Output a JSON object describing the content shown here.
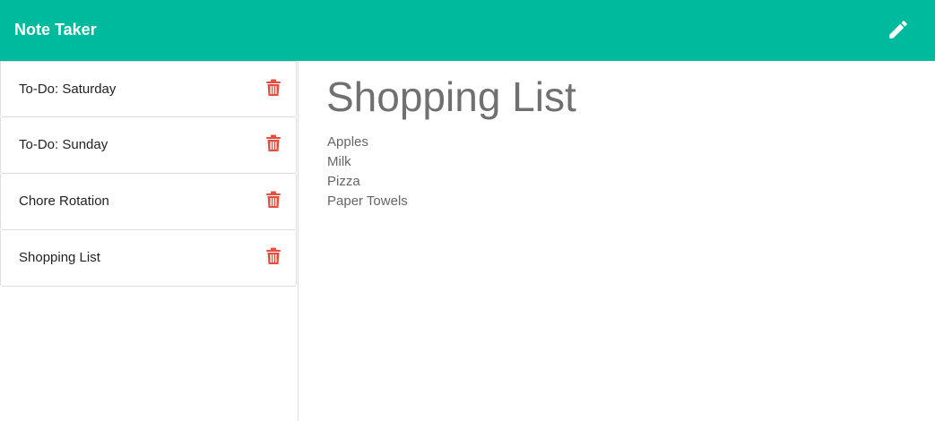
{
  "header": {
    "brand": "Note Taker",
    "new_note_icon": "pencil-icon",
    "bg_color": "#00ba9d"
  },
  "notes": [
    {
      "title": "To-Do: Saturday",
      "delete_icon": "trash-icon"
    },
    {
      "title": "To-Do: Sunday",
      "delete_icon": "trash-icon"
    },
    {
      "title": "Chore Rotation",
      "delete_icon": "trash-icon"
    },
    {
      "title": "Shopping List",
      "delete_icon": "trash-icon"
    }
  ],
  "active_note": {
    "title": "Shopping List",
    "lines": [
      "Apples",
      "Milk",
      "Pizza",
      "Paper Towels"
    ]
  },
  "colors": {
    "accent": "#00ba9d",
    "delete": "#e74c3c"
  }
}
